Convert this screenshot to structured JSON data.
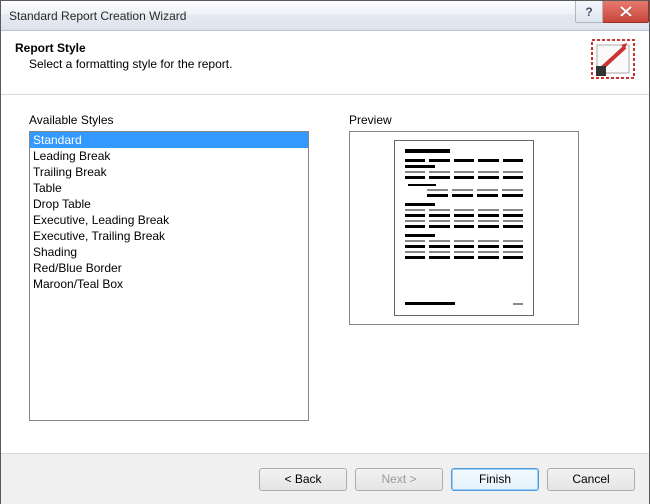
{
  "window": {
    "title": "Standard Report Creation Wizard"
  },
  "header": {
    "title": "Report Style",
    "subtitle": "Select a formatting style for the report."
  },
  "labels": {
    "available_styles": "Available Styles",
    "preview": "Preview"
  },
  "styles_list": {
    "selected_index": 0,
    "items": [
      "Standard",
      "Leading Break",
      "Trailing Break",
      "Table",
      "Drop Table",
      "Executive, Leading Break",
      "Executive, Trailing Break",
      "Shading",
      "Red/Blue Border",
      "Maroon/Teal Box"
    ]
  },
  "buttons": {
    "back": "< Back",
    "next": "Next >",
    "finish": "Finish",
    "cancel": "Cancel"
  }
}
